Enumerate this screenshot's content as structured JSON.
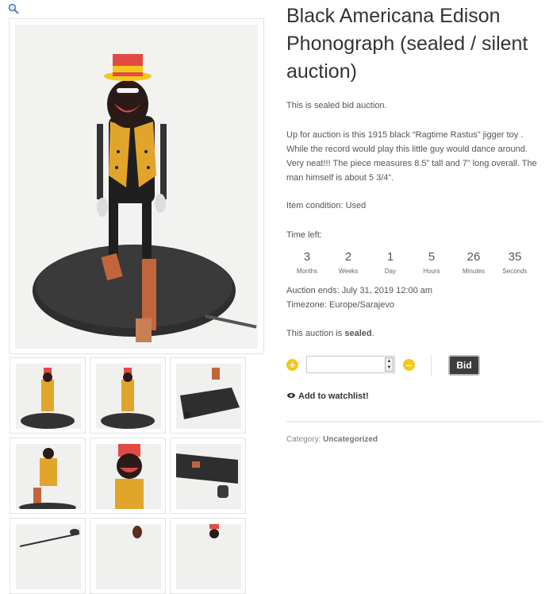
{
  "gallery": {
    "zoom_icon": "magnifier-icon",
    "main_image_alt": "",
    "thumbnail_count": 9
  },
  "product": {
    "title": "Black Americana Edison Phonograph (sealed / silent auction)",
    "intro": "This is sealed bid auction.",
    "description": "Up for auction is this 1915 black “Ragtime Rastus” jigger toy . While the record would play this little guy would dance around. Very neat!!! The piece measures 8.5” tall and 7” long overall. The man himself is about 5 3/4”.",
    "condition": "Item condition: Used"
  },
  "auction": {
    "time_left_label": "Time left:",
    "countdown": [
      {
        "value": "3",
        "label": "Months"
      },
      {
        "value": "2",
        "label": "Weeks"
      },
      {
        "value": "1",
        "label": "Day"
      },
      {
        "value": "5",
        "label": "Hours"
      },
      {
        "value": "26",
        "label": "Minutes"
      },
      {
        "value": "35",
        "label": "Seconds"
      }
    ],
    "ends": "Auction ends: July 31, 2019 12:00 am",
    "timezone": "Timezone: Europe/Sarajevo",
    "sealed_prefix": "This auction is ",
    "sealed_word": "sealed",
    "sealed_suffix": ".",
    "plus_symbol": "+",
    "minus_symbol": "–",
    "bid_value": "",
    "bid_button": "Bid",
    "watchlist": "Add to watchlist!"
  },
  "meta": {
    "category_label": "Category: ",
    "category_value": "Uncategorized"
  },
  "colors": {
    "accent_yellow": "#f2c81a",
    "button_dark": "#3d3d3d",
    "text": "#555555",
    "heading": "#333333"
  }
}
